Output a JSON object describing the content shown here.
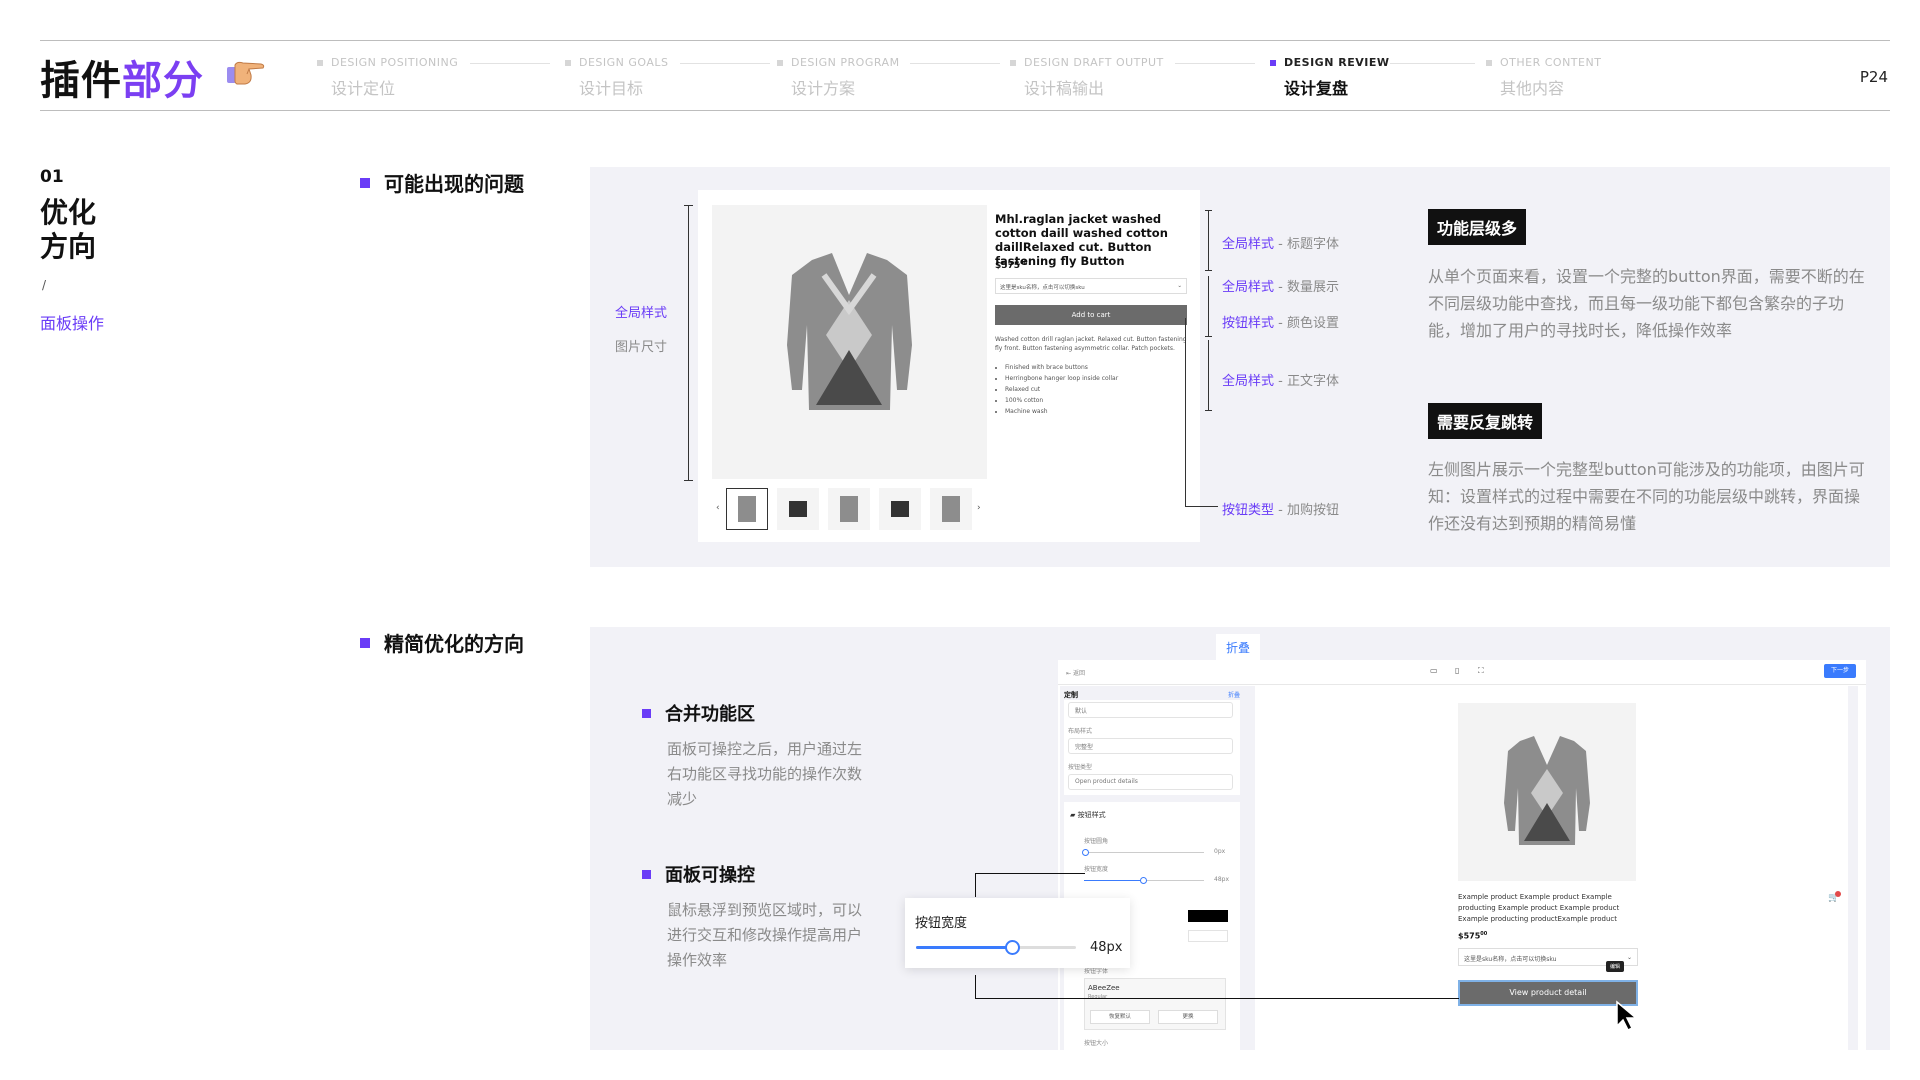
{
  "header": {
    "title_main": "插件",
    "title_accent": "部分",
    "hand_icon": "pointing-hand-icon",
    "steps": [
      {
        "en": "DESIGN POSITIONING",
        "zh": "设计定位",
        "active": false
      },
      {
        "en": "DESIGN GOALS",
        "zh": "设计目标",
        "active": false
      },
      {
        "en": "DESIGN PROGRAM",
        "zh": "设计方案",
        "active": false
      },
      {
        "en": "DESIGN DRAFT OUTPUT",
        "zh": "设计稿输出",
        "active": false
      },
      {
        "en": "DESIGN REVIEW",
        "zh": "设计复盘",
        "active": true
      },
      {
        "en": "OTHER CONTENT",
        "zh": "其他内容",
        "active": false
      }
    ],
    "page_number": "P24"
  },
  "sidebar": {
    "number": "01",
    "title_line1": "优化",
    "title_line2": "方向",
    "slash": "/",
    "link": "面板操作"
  },
  "section1": {
    "heading": "可能出现的问题",
    "left_label_purple": "全局样式",
    "left_label_gray": "图片尺寸",
    "product": {
      "title": "Mhl.raglan jacket washed cotton daill washed cotton daillRelaxed cut. Button fastening fly Button",
      "price": "$575",
      "price_sup": "00",
      "select_placeholder": "这里是sku名称，点击可以切换sku",
      "add_to_cart": "Add to cart",
      "description": "Washed cotton drill raglan jacket. Relaxed cut. Button fastening fly front. Button fastening asymmetric collar. Patch pockets.",
      "features": [
        "Finished with brace buttons",
        "Herringbone hanger loop inside collar",
        "Relaxed cut",
        "100% cotton",
        "Machine wash"
      ]
    },
    "annotations": [
      {
        "purple": "全局样式",
        "gray": "标题字体"
      },
      {
        "purple": "全局样式",
        "gray": "数量展示"
      },
      {
        "purple": "按钮样式",
        "gray": "颜色设置"
      },
      {
        "purple": "全局样式",
        "gray": "正文字体"
      },
      {
        "purple": "按钮类型",
        "gray": "加购按钮"
      }
    ],
    "dash": "-",
    "problem1_badge": "功能层级多",
    "problem1_text": "从单个页面来看，设置一个完整的button界面，需要不断的在不同层级功能中查找，而且每一级功能下都包含繁杂的子功能，增加了用户的寻找时长，降低操作效率",
    "problem2_badge": "需要反复跳转",
    "problem2_text": "左侧图片展示一个完整型button可能涉及的功能项，由图片可知：设置样式的过程中需要在不同的功能层级中跳转，界面操作还没有达到预期的精简易懂"
  },
  "section2": {
    "heading": "精简优化的方向",
    "point1_title": "合并功能区",
    "point1_text": "面板可操控之后，用户通过左右功能区寻找功能的操作次数减少",
    "point2_title": "面板可操控",
    "point2_text": "鼠标悬浮到预览区域时，可以进行交互和修改操作提高用户操作效率",
    "fold_tag": "折叠",
    "editor": {
      "back": "返回",
      "next_button": "下一步",
      "panel_title": "定制",
      "fold_link": "折叠",
      "field_top": "默认",
      "layout_label": "布局样式",
      "layout_value": "完整型",
      "btn_type_label": "按钮类型",
      "btn_type_value": "Open product details",
      "btn_style_label": "按钮样式",
      "radius_label": "按钮圆角",
      "radius_value": "0px",
      "width_label": "按钮宽度",
      "width_value": "48px",
      "font_label": "按钮字体",
      "font_value": "ABeeZee",
      "font_style": "Regular",
      "restore_button": "恢复默认",
      "change_button": "更换",
      "size_label": "按钮大小",
      "preview_desc": "Example product Example product Example producting Example product Example product Example producting productExample product",
      "preview_price": "$575",
      "preview_price_sup": "00",
      "preview_select": "这里是sku名称，点击可以切换sku",
      "tooltip": "编辑",
      "view_button": "View product detail"
    },
    "popover": {
      "label": "按钮宽度",
      "value": "48px",
      "fraction": 0.6
    }
  },
  "colors": {
    "accent": "#6a3cf7",
    "panel_bg": "#f2f2f7",
    "button_gray": "#6b6b6b",
    "blue": "#3a7bfd"
  }
}
